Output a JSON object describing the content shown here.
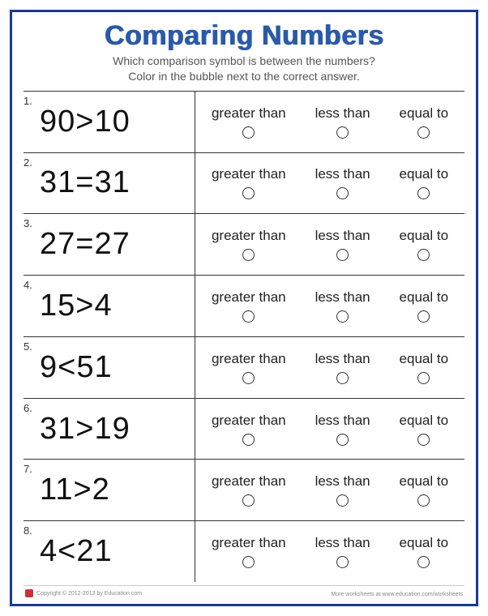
{
  "title": "Comparing Numbers",
  "instructions_line1": "Which comparison symbol is between the numbers?",
  "instructions_line2": "Color in the bubble next to the correct answer.",
  "option_labels": {
    "greater": "greater than",
    "less": "less than",
    "equal": "equal to"
  },
  "problems": [
    {
      "num": "1.",
      "expr": "90>10"
    },
    {
      "num": "2.",
      "expr": "31=31"
    },
    {
      "num": "3.",
      "expr": "27=27"
    },
    {
      "num": "4.",
      "expr": "15>4"
    },
    {
      "num": "5.",
      "expr": "9<51"
    },
    {
      "num": "6.",
      "expr": "31>19"
    },
    {
      "num": "7.",
      "expr": "11>2"
    },
    {
      "num": "8.",
      "expr": "4<21"
    }
  ],
  "footer": {
    "copyright": "Copyright © 2012-2013 by Education.com",
    "link": "More worksheets at www.education.com/worksheets"
  }
}
